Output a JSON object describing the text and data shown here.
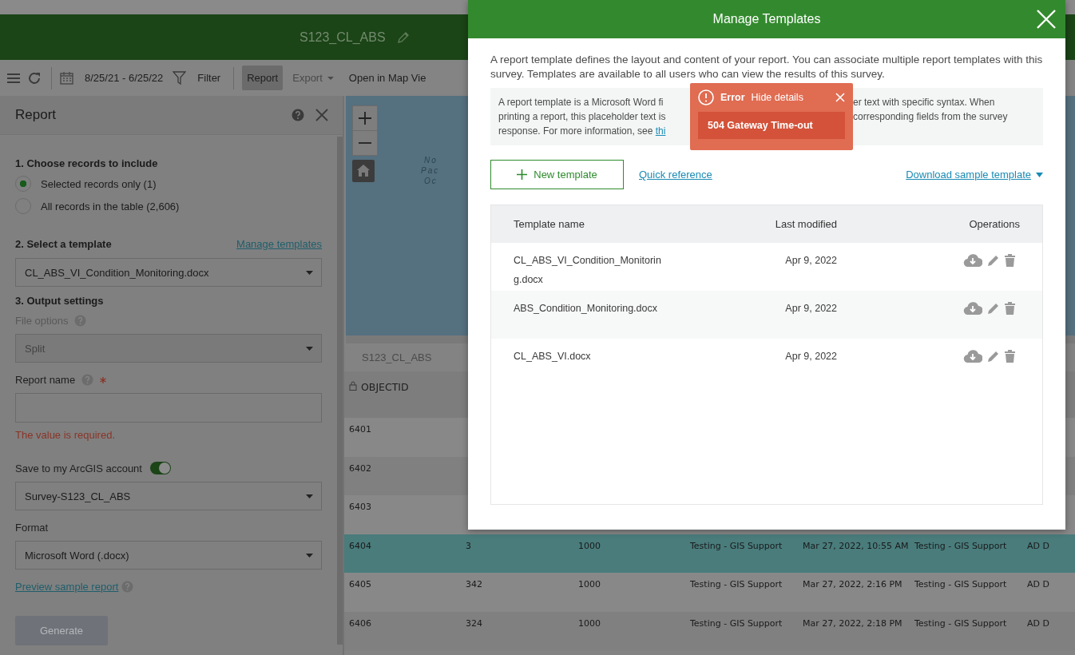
{
  "app_header": {
    "title": "S123_CL_ABS"
  },
  "toolbar": {
    "items": [
      {
        "kind": "date",
        "label": "8/25/21 - 6/25/22",
        "selected": false
      },
      {
        "kind": "filter",
        "label": "Filter",
        "selected": false
      },
      {
        "kind": "button",
        "label": "Report",
        "selected": true
      },
      {
        "kind": "dropdown",
        "label": "Export",
        "selected": false
      },
      {
        "kind": "button",
        "label": "Open in Map Vie",
        "selected": false
      }
    ]
  },
  "report_panel": {
    "title": "Report",
    "records": {
      "heading": "1. Choose records to include",
      "options": [
        {
          "label": "Selected records only (1)",
          "selected": true
        },
        {
          "label": "All records in the table (2,606)",
          "selected": false
        }
      ]
    },
    "template": {
      "heading": "2. Select a template",
      "link": "Manage templates",
      "value": "CL_ABS_VI_Condition_Monitoring.docx"
    },
    "output": {
      "heading": "3. Output settings",
      "file_options": {
        "label": "File options",
        "value": "Split",
        "disabled": true
      },
      "report_name": {
        "label": "Report name",
        "required": true,
        "error": "The value is required."
      },
      "save": {
        "label": "Save to my ArcGIS account",
        "on": true,
        "value": "Survey-S123_CL_ABS"
      },
      "format": {
        "label": "Format",
        "value": "Microsoft Word (.docx)"
      },
      "preview_link": "Preview sample report"
    },
    "generate": {
      "label": "Generate",
      "disabled": true
    }
  },
  "map": {
    "labels": [
      "No",
      "Pac",
      "Oc"
    ]
  },
  "table": {
    "tab": "S123_CL_ABS",
    "columns": [
      "OBJECTID"
    ],
    "rows": [
      {
        "cells": [
          "6401"
        ],
        "selected": false
      },
      {
        "cells": [
          "6402"
        ],
        "selected": false
      },
      {
        "cells": [
          "6403"
        ],
        "selected": false
      },
      {
        "cells": [
          "6404",
          "3",
          "1000",
          "Testing - GIS Support",
          "Mar 27, 2022, 10:55 AM",
          "Testing - GIS Support",
          "AD D"
        ],
        "selected": true
      },
      {
        "cells": [
          "6405",
          "342",
          "1000",
          "Testing - GIS Support",
          "Mar 27, 2022, 2:16 PM",
          "Testing - GIS Support",
          "AD D"
        ],
        "selected": false
      },
      {
        "cells": [
          "6406",
          "324",
          "1000",
          "Testing - GIS Support",
          "Mar 27, 2022, 2:18 PM",
          "Testing - GIS Support",
          "AD D"
        ],
        "selected": false
      }
    ]
  },
  "modal": {
    "title": "Manage Templates",
    "intro": "A report template defines the layout and content of your report. You can associate multiple report templates with this survey. Templates are available to all users who can view the results of this survey.",
    "info_lines": [
      {
        "left": "A report template is a Microsoft Word fi",
        "right": "er text with specific syntax. When"
      },
      {
        "left": "printing a report, this placeholder text is",
        "right": "corresponding fields from the survey"
      },
      {
        "left": "response. For more information, see ",
        "link": "thi"
      }
    ],
    "new_button": "New template",
    "quick_link": "Quick reference",
    "download_link": "Download sample template",
    "templates": {
      "columns": [
        "Template name",
        "Last modified",
        "Operations"
      ],
      "rows": [
        {
          "name": "CL_ABS_VI_Condition_Monitoring.docx",
          "modified": "Apr 9, 2022"
        },
        {
          "name": "ABS_Condition_Monitoring.docx",
          "modified": "Apr 9, 2022"
        },
        {
          "name": "CL_ABS_VI.docx",
          "modified": "Apr 9, 2022"
        }
      ]
    }
  },
  "error": {
    "title": "Error",
    "toggle": "Hide details",
    "detail": "504 Gateway Time-out"
  }
}
